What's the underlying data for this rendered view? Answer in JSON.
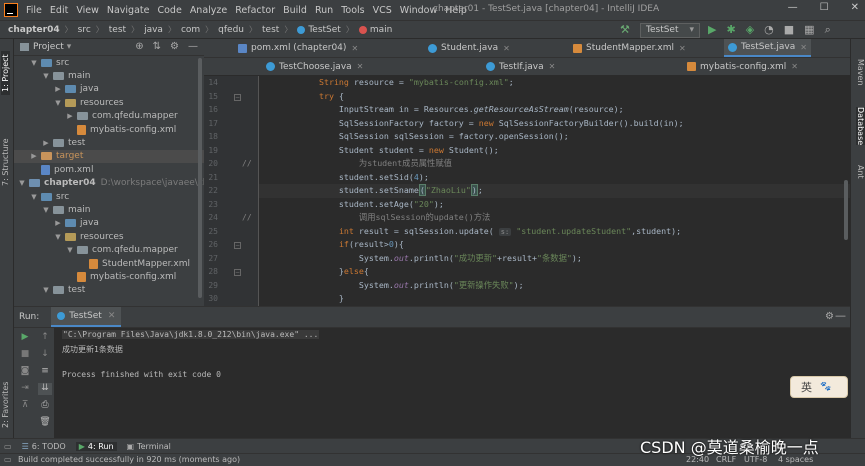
{
  "menubar": {
    "items": [
      "File",
      "Edit",
      "View",
      "Navigate",
      "Code",
      "Analyze",
      "Refactor",
      "Build",
      "Run",
      "Tools",
      "VCS",
      "Window",
      "Help"
    ],
    "title": "chapter01 - TestSet.java [chapter04] - IntelliJ IDEA",
    "controls": [
      "—",
      "☐",
      "✕"
    ]
  },
  "breadcrumb": [
    "chapter04",
    "src",
    "test",
    "java",
    "com",
    "qfedu",
    "test",
    "TestSet",
    "main"
  ],
  "run_config": "TestSet",
  "left_tools": [
    "1: Project",
    "7: Structure",
    "2: Favorites"
  ],
  "right_tools": [
    "Maven",
    "Database",
    "Ant"
  ],
  "project": {
    "title": "Project",
    "rows": [
      {
        "indent": 1,
        "arrow": "▼",
        "icon": "src",
        "label": "src"
      },
      {
        "indent": 2,
        "arrow": "▼",
        "icon": "fold",
        "label": "main"
      },
      {
        "indent": 3,
        "arrow": "▶",
        "icon": "src",
        "label": "java"
      },
      {
        "indent": 3,
        "arrow": "▼",
        "icon": "res",
        "label": "resources"
      },
      {
        "indent": 4,
        "arrow": "▶",
        "icon": "fold",
        "label": "com.qfedu.mapper"
      },
      {
        "indent": 4,
        "arrow": "",
        "icon": "x",
        "label": "mybatis-config.xml"
      },
      {
        "indent": 2,
        "arrow": "▶",
        "icon": "fold",
        "label": "test"
      },
      {
        "indent": 1,
        "arrow": "▶",
        "icon": "tgt",
        "label": "target",
        "sel": true
      },
      {
        "indent": 1,
        "arrow": "",
        "icon": "m",
        "label": "pom.xml"
      },
      {
        "indent": 0,
        "arrow": "▼",
        "icon": "mod",
        "label": "chapter04",
        "extra": "D:\\workspace\\javaee\\chapter0"
      },
      {
        "indent": 1,
        "arrow": "▼",
        "icon": "src",
        "label": "src"
      },
      {
        "indent": 2,
        "arrow": "▼",
        "icon": "fold",
        "label": "main"
      },
      {
        "indent": 3,
        "arrow": "▶",
        "icon": "src",
        "label": "java"
      },
      {
        "indent": 3,
        "arrow": "▼",
        "icon": "res",
        "label": "resources"
      },
      {
        "indent": 4,
        "arrow": "▼",
        "icon": "fold",
        "label": "com.qfedu.mapper"
      },
      {
        "indent": 5,
        "arrow": "",
        "icon": "x",
        "label": "StudentMapper.xml"
      },
      {
        "indent": 4,
        "arrow": "",
        "icon": "x",
        "label": "mybatis-config.xml"
      },
      {
        "indent": 2,
        "arrow": "▼",
        "icon": "fold",
        "label": "test"
      }
    ]
  },
  "tabs_row1": [
    {
      "label": "pom.xml (chapter04)",
      "icon": "m"
    },
    {
      "label": "Student.java",
      "icon": "c"
    },
    {
      "label": "StudentMapper.xml",
      "icon": "x"
    },
    {
      "label": "TestSet.java",
      "icon": "c",
      "active": true
    }
  ],
  "tabs_row2": [
    {
      "label": "TestChoose.java",
      "icon": "c"
    },
    {
      "label": "TestIf.java",
      "icon": "c"
    },
    {
      "label": "mybatis-config.xml",
      "icon": "x"
    }
  ],
  "editor": {
    "line_numbers": [
      "14",
      "15",
      "16",
      "17",
      "18",
      "19",
      "20",
      "21",
      "22",
      "23",
      "24",
      "25",
      "26",
      "27",
      "28",
      "29",
      "30"
    ],
    "comment_markers": {
      "6": "//",
      "10": "//"
    },
    "lines": [
      "            String resource = \"mybatis-config.xml\";",
      "            try {",
      "                InputStream in = Resources.getResourceAsStream(resource);",
      "                SqlSessionFactory factory = new SqlSessionFactoryBuilder().build(in);",
      "                SqlSession sqlSession = factory.openSession();",
      "                Student student = new Student();",
      "                    为student成员属性赋值",
      "                student.setSid(4);",
      "                student.setSname(\"ZhaoLiu\");",
      "                student.setAge(\"20\");",
      "                    调用sqlSession的update()方法",
      "                int result = sqlSession.update( s: \"student.updateStudent\",student);",
      "                if(result>0){",
      "                    System.out.println(\"成功更新\"+result+\"条数据\");",
      "                }else{",
      "                    System.out.println(\"更新操作失败\");",
      "                }"
    ]
  },
  "run": {
    "label": "Run:",
    "tab": "TestSet",
    "console": [
      "\"C:\\Program Files\\Java\\jdk1.8.0_212\\bin\\java.exe\" ...",
      "成功更新1条数据",
      "",
      "Process finished with exit code 0"
    ]
  },
  "bottom_tabs": [
    "6: TODO",
    "4: Run",
    "Terminal"
  ],
  "status": {
    "message": "Build completed successfully in 920 ms (moments ago)",
    "position": "22:40",
    "line_sep": "CRLF",
    "encoding": "UTF-8",
    "indent": "4 spaces"
  },
  "ime": "英",
  "watermark": "CSDN @莫道桑榆晚一点"
}
